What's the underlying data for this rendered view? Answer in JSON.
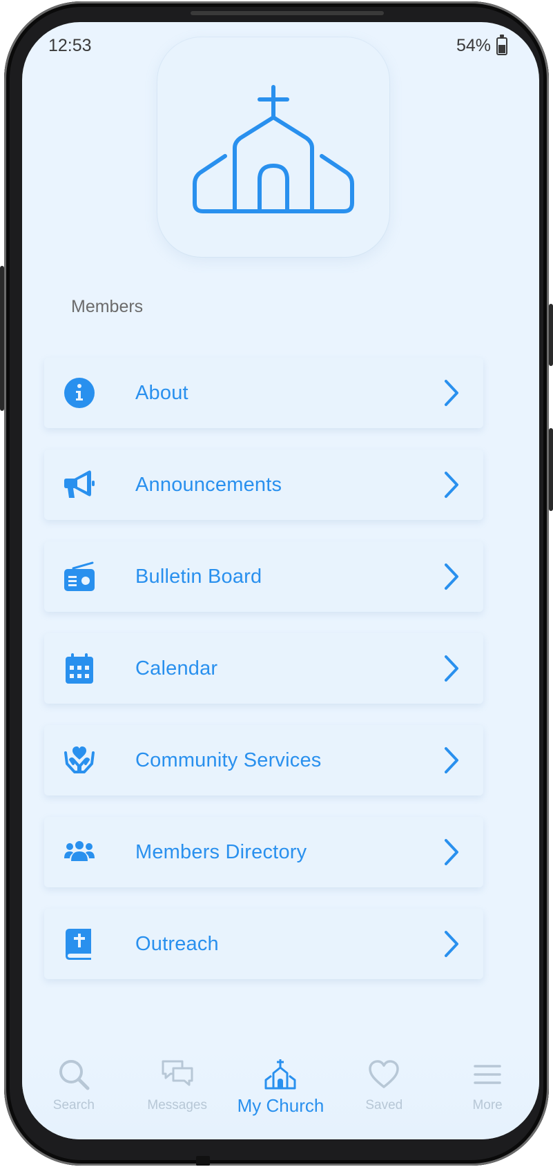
{
  "status_bar": {
    "time": "12:53",
    "battery": "54%"
  },
  "section_title": "Members",
  "menu": [
    {
      "label": "About",
      "icon": "info-icon"
    },
    {
      "label": "Announcements",
      "icon": "megaphone-icon"
    },
    {
      "label": "Bulletin Board",
      "icon": "radio-icon"
    },
    {
      "label": "Calendar",
      "icon": "calendar-icon"
    },
    {
      "label": "Community Services",
      "icon": "hands-heart-icon"
    },
    {
      "label": "Members Directory",
      "icon": "users-icon"
    },
    {
      "label": "Outreach",
      "icon": "bible-icon"
    }
  ],
  "tabs": [
    {
      "label": "Search",
      "icon": "search-icon",
      "active": false
    },
    {
      "label": "Messages",
      "icon": "messages-icon",
      "active": false
    },
    {
      "label": "My Church",
      "icon": "church-icon",
      "active": true
    },
    {
      "label": "Saved",
      "icon": "heart-icon",
      "active": false
    },
    {
      "label": "More",
      "icon": "menu-icon",
      "active": false
    }
  ],
  "colors": {
    "accent": "#2990ee",
    "background": "#eaf4fe",
    "inactive_tab": "#b7c7d6",
    "section_title": "#6b6b6b"
  }
}
